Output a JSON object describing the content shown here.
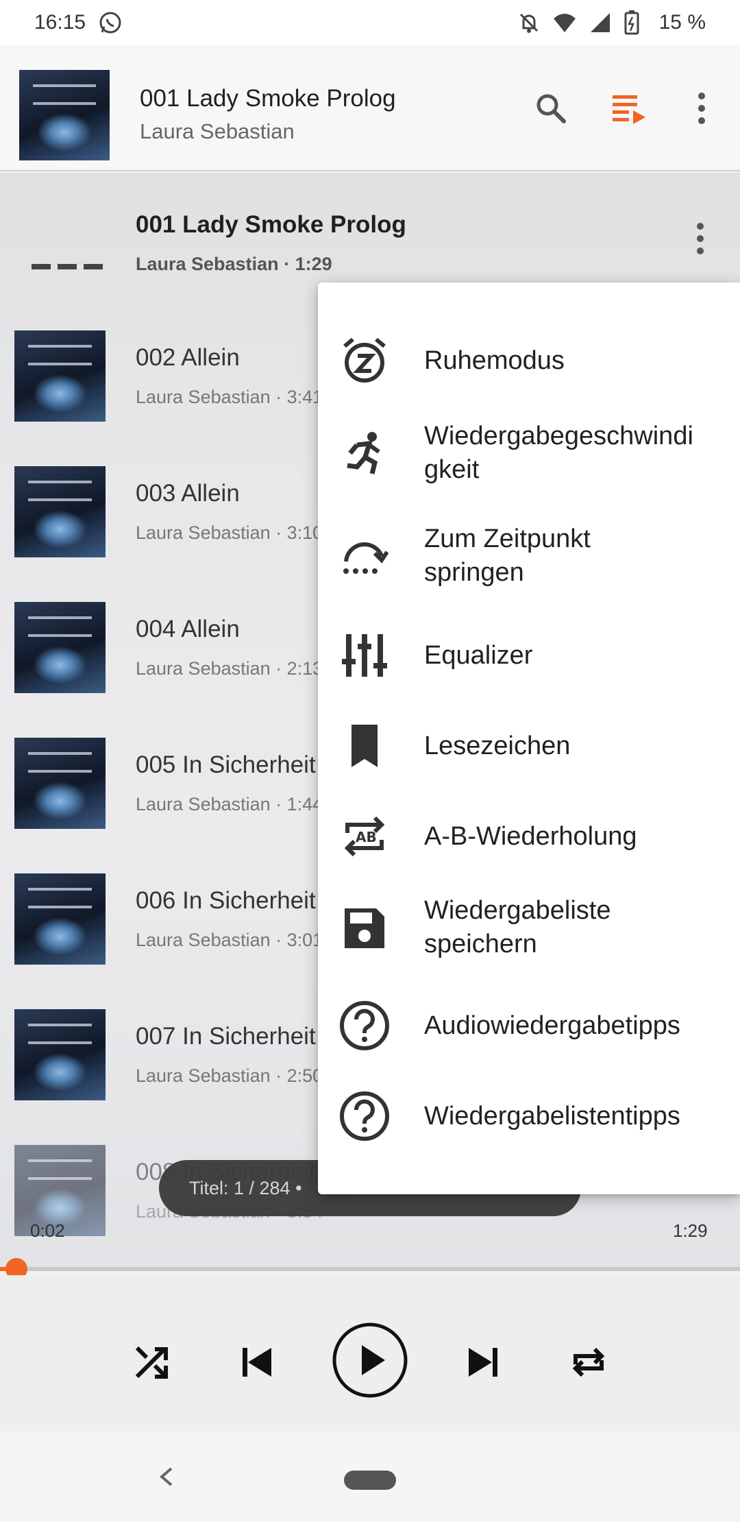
{
  "status_bar": {
    "time": "16:15",
    "battery": "15 %",
    "icons": [
      "whatsapp-icon",
      "mute-icon",
      "wifi-icon",
      "signal-icon",
      "battery-icon"
    ]
  },
  "header": {
    "title": "001 Lady Smoke Prolog",
    "artist": "Laura Sebastian",
    "icons": [
      "search-icon",
      "queue-icon",
      "more-icon"
    ]
  },
  "playlist": [
    {
      "title": "001 Lady Smoke Prolog",
      "subtitle": "Laura Sebastian · 1:29",
      "current": true
    },
    {
      "title": "002 Allein",
      "subtitle": "Laura Sebastian · 3:41"
    },
    {
      "title": "003 Allein",
      "subtitle": "Laura Sebastian · 3:10"
    },
    {
      "title": "004 Allein",
      "subtitle": "Laura Sebastian · 2:13"
    },
    {
      "title": "005 In Sicherheit",
      "subtitle": "Laura Sebastian · 1:44"
    },
    {
      "title": "006 In Sicherheit",
      "subtitle": "Laura Sebastian · 3:01"
    },
    {
      "title": "007 In Sicherheit",
      "subtitle": "Laura Sebastian · 2:50"
    },
    {
      "title": "008 In Sicherheit",
      "subtitle": "Laura Sebastian · 3:54"
    }
  ],
  "snackbar": {
    "text": "Titel: 1 / 284 •"
  },
  "player": {
    "elapsed": "0:02",
    "duration": "1:29",
    "progress_fraction": 0.022,
    "accent_color": "#f26522"
  },
  "menu": {
    "items": [
      {
        "label": "Ruhemodus",
        "icon": "sleep-timer-icon"
      },
      {
        "label": "Wiedergabegeschwindigkeit",
        "line1": "Wiedergabegeschwindi",
        "line2": "gkeit",
        "icon": "running-person-icon"
      },
      {
        "label": "Zum Zeitpunkt springen",
        "line1": "Zum Zeitpunkt",
        "line2": "springen",
        "icon": "jump-to-time-icon"
      },
      {
        "label": "Equalizer",
        "icon": "equalizer-icon"
      },
      {
        "label": "Lesezeichen",
        "icon": "bookmark-icon"
      },
      {
        "label": "A-B-Wiederholung",
        "icon": "ab-repeat-icon"
      },
      {
        "label": "Wiedergabeliste speichern",
        "line1": "Wiedergabeliste",
        "line2": "speichern",
        "icon": "save-icon"
      },
      {
        "label": "Audiowiedergabetipps",
        "icon": "help-icon"
      },
      {
        "label": "Wiedergabelistentipps",
        "icon": "help-icon"
      }
    ]
  }
}
